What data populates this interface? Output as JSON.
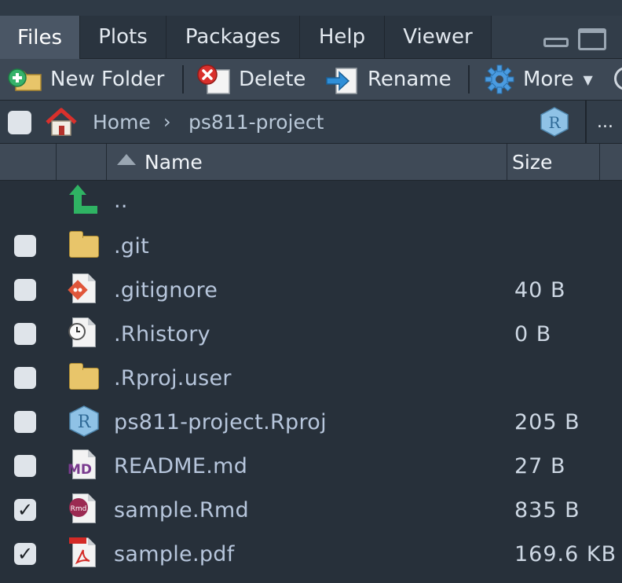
{
  "tabs": [
    {
      "label": "Files",
      "active": true
    },
    {
      "label": "Plots",
      "active": false
    },
    {
      "label": "Packages",
      "active": false
    },
    {
      "label": "Help",
      "active": false
    },
    {
      "label": "Viewer",
      "active": false
    }
  ],
  "toolbar": {
    "new_folder": "New Folder",
    "delete": "Delete",
    "rename": "Rename",
    "more": "More"
  },
  "path": {
    "home": "Home",
    "separator": "›",
    "current": "ps811-project",
    "overflow": "..."
  },
  "columns": {
    "name": "Name",
    "size": "Size"
  },
  "parent_link": "..",
  "files": [
    {
      "name": ".git",
      "size": "",
      "icon": "folder-icon",
      "checked": false
    },
    {
      "name": ".gitignore",
      "size": "40 B",
      "icon": "git-file-icon",
      "checked": false
    },
    {
      "name": ".Rhistory",
      "size": "0 B",
      "icon": "history-file-icon",
      "checked": false
    },
    {
      "name": ".Rproj.user",
      "size": "",
      "icon": "folder-icon",
      "checked": false
    },
    {
      "name": "ps811-project.Rproj",
      "size": "205 B",
      "icon": "rproj-file-icon",
      "checked": false
    },
    {
      "name": "README.md",
      "size": "27 B",
      "icon": "markdown-file-icon",
      "checked": false
    },
    {
      "name": "sample.Rmd",
      "size": "835 B",
      "icon": "rmd-file-icon",
      "checked": true
    },
    {
      "name": "sample.pdf",
      "size": "169.6 KB",
      "icon": "pdf-file-icon",
      "checked": true
    }
  ],
  "colors": {
    "background": "#27303a",
    "filename": "#b7c6dc",
    "active_tab": "#4a5665"
  }
}
